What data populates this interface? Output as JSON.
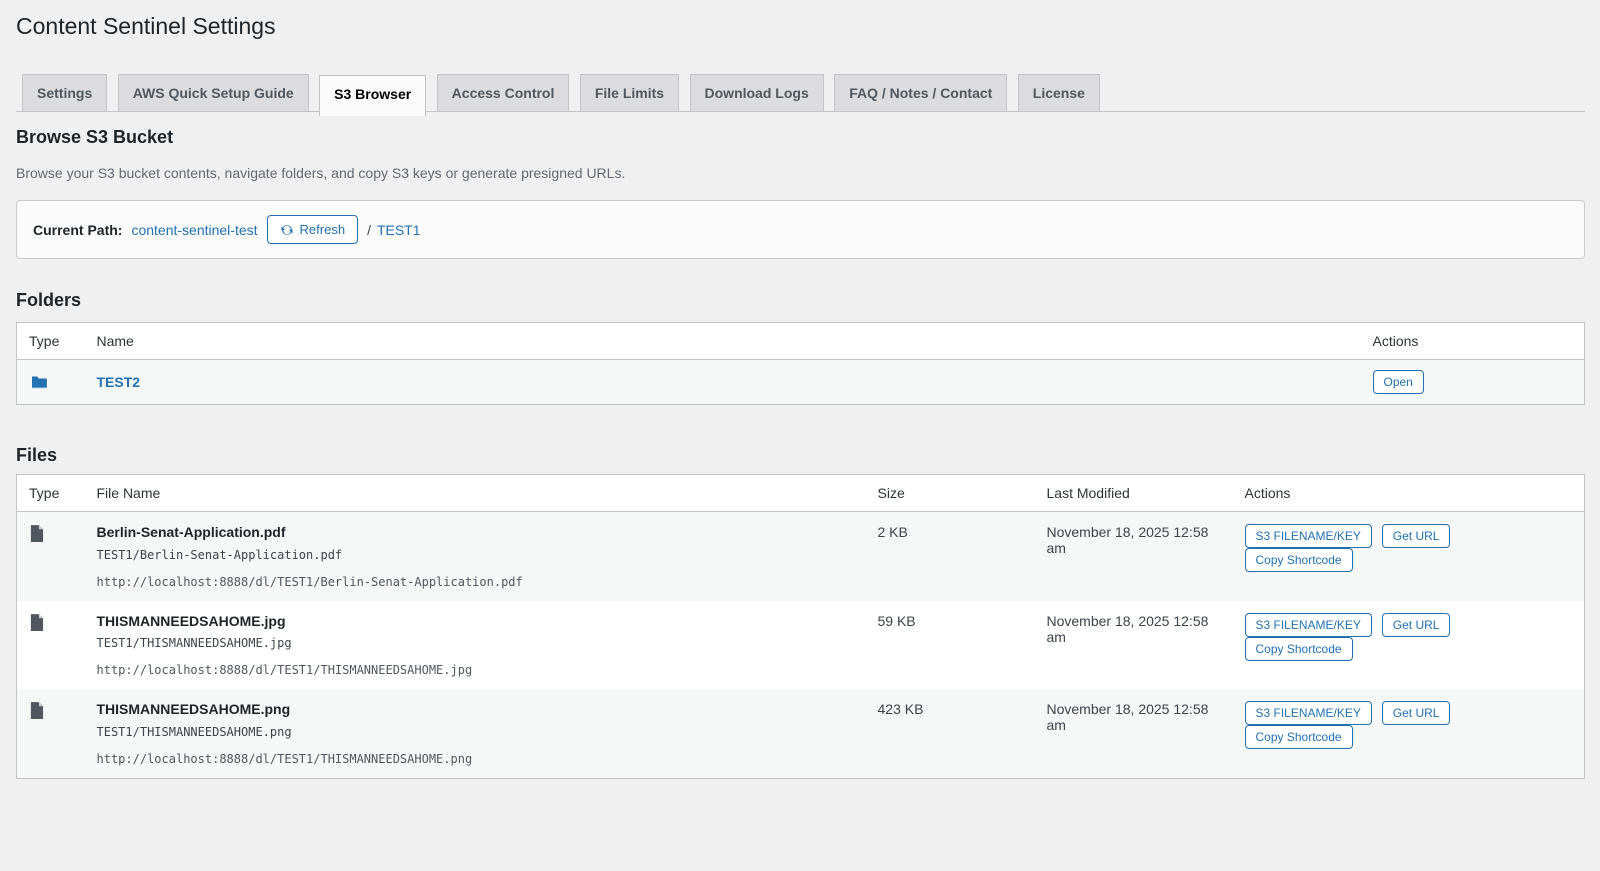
{
  "page": {
    "title": "Content Sentinel Settings"
  },
  "tabs": [
    {
      "label": "Settings"
    },
    {
      "label": "AWS Quick Setup Guide"
    },
    {
      "label": "S3 Browser",
      "active": true
    },
    {
      "label": "Access Control"
    },
    {
      "label": "File Limits"
    },
    {
      "label": "Download Logs"
    },
    {
      "label": "FAQ / Notes / Contact"
    },
    {
      "label": "License"
    }
  ],
  "browser": {
    "heading": "Browse S3 Bucket",
    "description": "Browse your S3 bucket contents, navigate folders, and copy S3 keys or generate presigned URLs.",
    "current_path": {
      "label": "Current Path:",
      "bucket": "content-sentinel-test",
      "refresh_label": "Refresh",
      "separator": "/",
      "segment": "TEST1"
    }
  },
  "folders": {
    "heading": "Folders",
    "columns": [
      "Type",
      "Name",
      "Actions"
    ],
    "rows": [
      {
        "name": "TEST2",
        "action": "Open",
        "icon": "folder-icon"
      }
    ]
  },
  "files": {
    "heading": "Files",
    "columns": [
      "Type",
      "File Name",
      "Size",
      "Last Modified",
      "Actions"
    ],
    "action_labels": [
      "S3 FILENAME/KEY",
      "Get URL",
      "Copy Shortcode"
    ],
    "rows": [
      {
        "name": "Berlin-Senat-Application.pdf",
        "key": "TEST1/Berlin-Senat-Application.pdf",
        "url": "http://localhost:8888/dl/TEST1/Berlin-Senat-Application.pdf",
        "size": "2 KB",
        "modified": "November 18, 2025 12:58 am",
        "icon": "file-icon"
      },
      {
        "name": "THISMANNEEDSAHOME.jpg",
        "key": "TEST1/THISMANNEEDSAHOME.jpg",
        "url": "http://localhost:8888/dl/TEST1/THISMANNEEDSAHOME.jpg",
        "size": "59 KB",
        "modified": "November 18, 2025 12:58 am",
        "icon": "file-icon"
      },
      {
        "name": "THISMANNEEDSAHOME.png",
        "key": "TEST1/THISMANNEEDSAHOME.png",
        "url": "http://localhost:8888/dl/TEST1/THISMANNEEDSAHOME.png",
        "size": "423 KB",
        "modified": "November 18, 2025 12:58 am",
        "icon": "file-icon"
      }
    ]
  },
  "colors": {
    "accent_link": "#2271b1",
    "page_background": "#f0f0f1",
    "heading_text": "#1d2327",
    "muted_text": "#646970",
    "row_stripe": "#f6f7f7",
    "border": "#c3c4c7",
    "tab_inactive": "#dcdcde",
    "file_icon_gray": "#50575e"
  }
}
